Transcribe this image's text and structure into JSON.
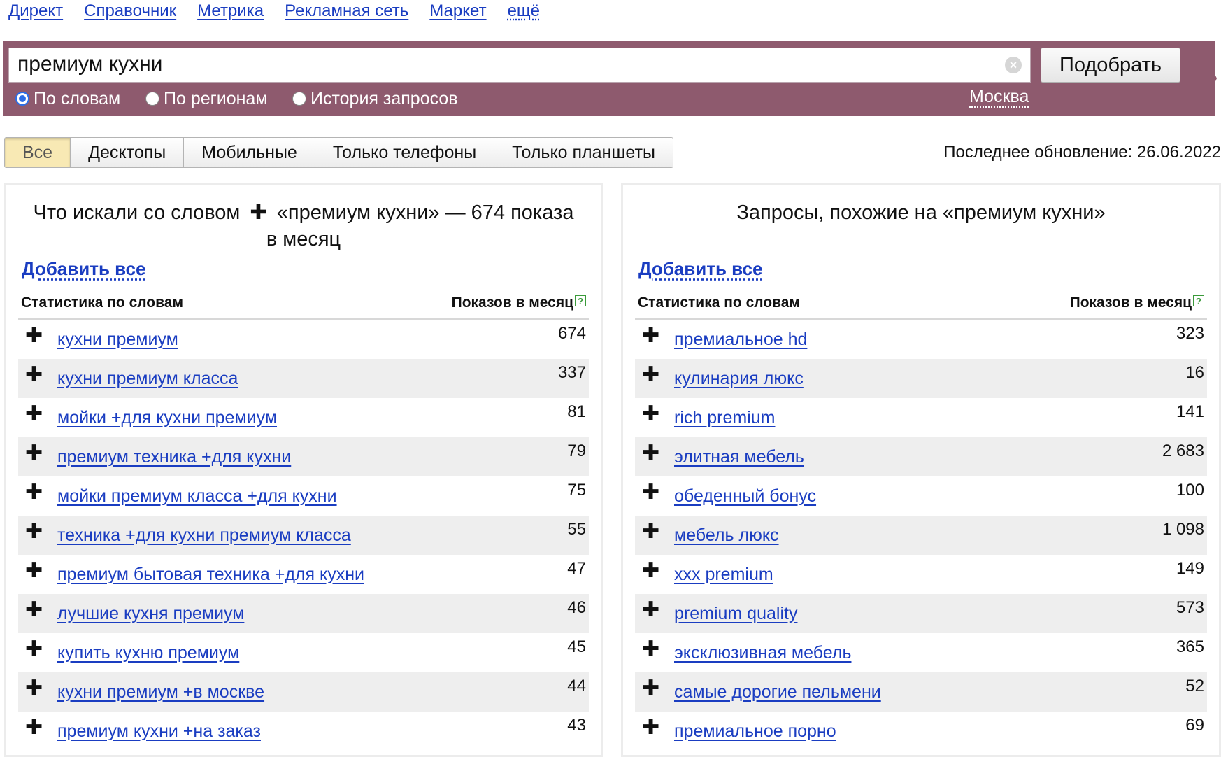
{
  "topnav": {
    "items": [
      "Директ",
      "Справочник",
      "Метрика",
      "Рекламная сеть",
      "Маркет",
      "ещё"
    ]
  },
  "search": {
    "value": "премиум кухни",
    "submit_label": "Подобрать",
    "modes": [
      "По словам",
      "По регионам",
      "История запросов"
    ],
    "selected_mode": "По словам",
    "region": "Москва"
  },
  "tabs": {
    "items": [
      "Все",
      "Десктопы",
      "Мобильные",
      "Только телефоны",
      "Только планшеты"
    ],
    "active": "Все"
  },
  "last_update": "Последнее обновление: 26.06.2022",
  "colors": {
    "band": "#8e5a6e",
    "link": "#1a3dc1",
    "active_tab": "#f8e9b4",
    "row_alt": "#eeeeee"
  },
  "left_panel": {
    "title_before": "Что искали со словом",
    "title_after": "«премиум кухни» — 674 показа в месяц",
    "add_all": "Добавить все",
    "col_words": "Статистика по словам",
    "col_count": "Показов в месяц",
    "rows": [
      {
        "phrase": "кухни премиум",
        "count": "674"
      },
      {
        "phrase": "кухни премиум класса",
        "count": "337"
      },
      {
        "phrase": "мойки +для кухни премиум",
        "count": "81"
      },
      {
        "phrase": "премиум техника +для кухни",
        "count": "79"
      },
      {
        "phrase": "мойки премиум класса +для кухни",
        "count": "75"
      },
      {
        "phrase": "техника +для кухни премиум класса",
        "count": "55"
      },
      {
        "phrase": "премиум бытовая техника +для кухни",
        "count": "47"
      },
      {
        "phrase": "лучшие кухня премиум",
        "count": "46"
      },
      {
        "phrase": "купить кухню премиум",
        "count": "45"
      },
      {
        "phrase": "кухни премиум +в москве",
        "count": "44"
      },
      {
        "phrase": "премиум кухни +на заказ",
        "count": "43"
      }
    ]
  },
  "right_panel": {
    "title": "Запросы, похожие на «премиум кухни»",
    "add_all": "Добавить все",
    "col_words": "Статистика по словам",
    "col_count": "Показов в месяц",
    "rows": [
      {
        "phrase": "премиальное hd",
        "count": "323"
      },
      {
        "phrase": "кулинария люкс",
        "count": "16"
      },
      {
        "phrase": "rich premium",
        "count": "141"
      },
      {
        "phrase": "элитная мебель",
        "count": "2 683"
      },
      {
        "phrase": "обеденный бонус",
        "count": "100"
      },
      {
        "phrase": "мебель люкс",
        "count": "1 098"
      },
      {
        "phrase": "xxx premium",
        "count": "149"
      },
      {
        "phrase": "premium quality",
        "count": "573"
      },
      {
        "phrase": "эксклюзивная мебель",
        "count": "365"
      },
      {
        "phrase": "самые дорогие пельмени",
        "count": "52"
      },
      {
        "phrase": "премиальное порно",
        "count": "69"
      }
    ]
  }
}
